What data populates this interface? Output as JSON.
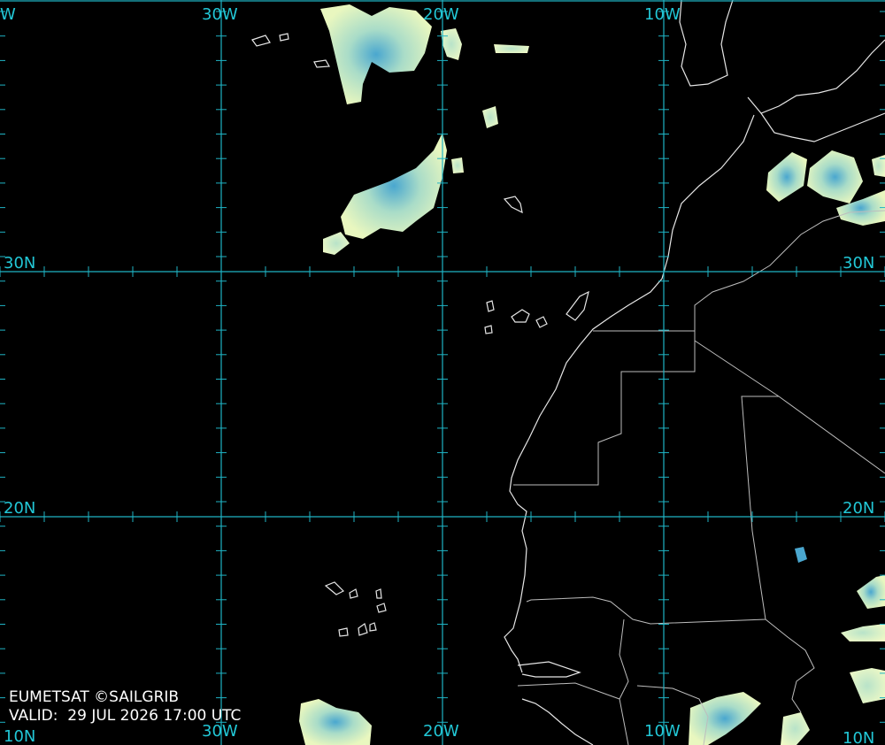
{
  "source_credit": "EUMETSAT ©SAILGRIB",
  "valid_label": "VALID:",
  "valid_datetime": "29 JUL 2026 17:00 UTC",
  "grid": {
    "longitude_labels": [
      "30W",
      "20W",
      "10W"
    ],
    "latitude_labels": [
      "30N",
      "20N"
    ],
    "corner_labels_top_left": "W",
    "corner_labels_bottom": [
      "10N",
      "10W"
    ]
  },
  "colors": {
    "background": "#000000",
    "grid": "#1fb3c4",
    "label": "#22c7d6",
    "coastline": "#e6e6e6",
    "cloud_light": "#e9f7bf",
    "cloud_mid": "#a9dcc8",
    "cloud_dense": "#4aa7cf"
  }
}
